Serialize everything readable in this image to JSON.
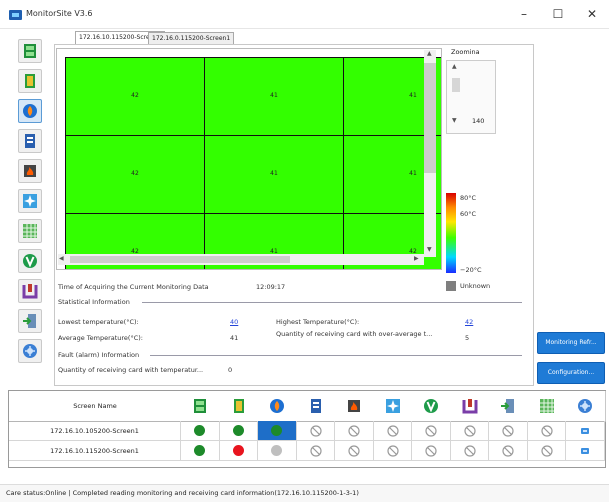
{
  "app": {
    "title": "MonitorSite V3.6",
    "minimize_glyph": "–",
    "maximize_glyph": "☐",
    "close_glyph": "✕"
  },
  "toolbar": {
    "icons": [
      "sending-card-icon",
      "receiving-card-icon",
      "temperature-icon",
      "humidity-icon",
      "smoke-icon",
      "fan-icon",
      "module-icon",
      "voltage-icon",
      "power-icon",
      "door-icon",
      "monitor-icon"
    ],
    "active_index": 2
  },
  "tabs": [
    {
      "label": "172.16.10.115200-Screen1",
      "active": true
    },
    {
      "label": "172.16.0.115200-Screen1",
      "active": false
    }
  ],
  "grid": {
    "color": "#33ff00",
    "rows": [
      [
        "42",
        "41",
        "41"
      ],
      [
        "42",
        "41",
        "41"
      ],
      [
        "42",
        "41",
        "42"
      ]
    ]
  },
  "zoom": {
    "label": "Zoomina",
    "value": "140"
  },
  "legend": {
    "max_label": "80°C",
    "mid_label": "60°C",
    "min_label": "−20°C",
    "unknown_label": "Unknown"
  },
  "acquire": {
    "label": "Time of Acquiring the Current Monitoring Data",
    "value": "12:09:17"
  },
  "stats": {
    "section_title": "Statistical Information",
    "lowest_label": "Lowest temperature(°C):",
    "lowest_value": "40",
    "highest_label": "Highest Temperature(°C):",
    "highest_value": "42",
    "average_label": "Average Temperature(°C):",
    "average_value": "41",
    "over_avg_label": "Quantity of receiving card with over-average t...",
    "over_avg_value": "5"
  },
  "fault": {
    "section_title": "Fault (alarm) Information",
    "qty_label": "Quantity of receiving card with temperatur...",
    "qty_value": "0"
  },
  "side_buttons": {
    "monitoring": "Monitoring Refr...",
    "configuration": "Configuration..."
  },
  "table": {
    "header": "Screen Name",
    "column_icons": [
      "sending-card-icon",
      "receiving-card-icon",
      "temperature-icon",
      "humidity-icon",
      "smoke-icon",
      "fan-icon",
      "voltage-icon",
      "power-icon",
      "door-icon",
      "module-icon",
      "monitor-icon"
    ],
    "rows": [
      {
        "name": "172.16.10.105200-Screen1",
        "status": [
          "ok",
          "ok",
          "ok",
          "na",
          "na",
          "na",
          "na",
          "na",
          "na",
          "na",
          "link"
        ]
      },
      {
        "name": "172.16.10.115200-Screen1",
        "status": [
          "ok",
          "error",
          "unknown",
          "na",
          "na",
          "na",
          "na",
          "na",
          "na",
          "na",
          "link"
        ]
      }
    ],
    "colors": {
      "ok": "#1d8a2a",
      "error": "#e8141e",
      "unknown": "#bfbfbf",
      "selected": "#1e6ec8"
    }
  },
  "status_bar": {
    "text": "Care status:Online  |  Completed reading monitoring and receiving card information(172.16.10.115200-1-3-1)"
  }
}
